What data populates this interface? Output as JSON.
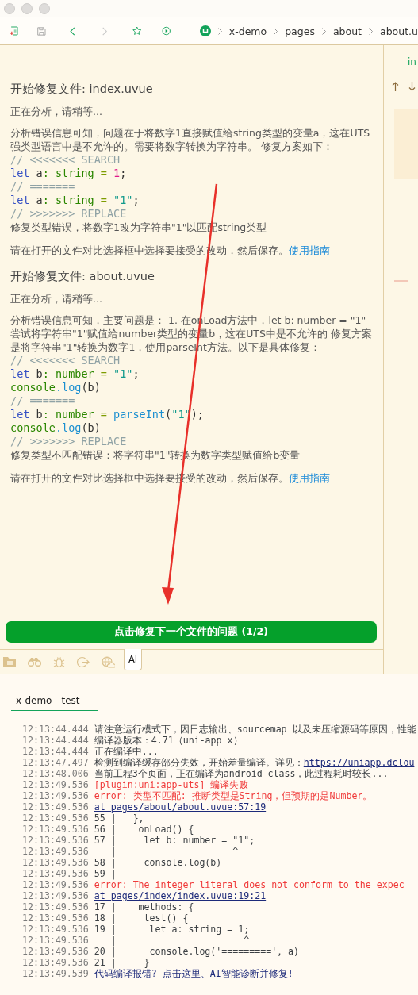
{
  "toolbar": {
    "breadcrumb": [
      "x-demo",
      "pages",
      "about",
      "about.u"
    ],
    "forward_disabled": true
  },
  "side_gutter": {
    "label": "in"
  },
  "ai_panel": {
    "sections": [
      {
        "heading": "开始修复文件: index.uvue",
        "status": "正在分析，请稍等...",
        "analysis": "分析错误信息可知，问题在于将数字1直接赋值给string类型的变量a，这在UTS强类型语言中是不允许的。需要将数字转换为字符串。 修复方案如下：",
        "code": [
          [
            {
              "text": "// <<<<<<< SEARCH",
              "kind": "comment"
            }
          ],
          [
            {
              "text": "let",
              "kind": "kw"
            },
            {
              "text": " a",
              "kind": "plain"
            },
            {
              "text": ": string",
              "kind": "type"
            },
            {
              "text": " = ",
              "kind": "op"
            },
            {
              "text": "1",
              "kind": "num"
            },
            {
              "text": ";",
              "kind": "plain"
            }
          ],
          [
            {
              "text": "// =======",
              "kind": "comment"
            }
          ],
          [
            {
              "text": "let",
              "kind": "kw"
            },
            {
              "text": " a",
              "kind": "plain"
            },
            {
              "text": ": string",
              "kind": "type"
            },
            {
              "text": " = ",
              "kind": "op"
            },
            {
              "text": "\"1\"",
              "kind": "str"
            },
            {
              "text": ";",
              "kind": "plain"
            }
          ],
          [
            {
              "text": "// >>>>>>> REPLACE",
              "kind": "comment"
            }
          ]
        ],
        "summary": "修复类型错误，将数字1改为字符串\"1\"以匹配string类型",
        "instruction": "请在打开的文件对比选择框中选择要接受的改动，然后保存。",
        "link": "使用指南"
      },
      {
        "heading": "开始修复文件: about.uvue",
        "status": "正在分析，请稍等...",
        "analysis": "分析错误信息可知，主要问题是： 1. 在onLoad方法中，let b: number = \"1\" 尝试将字符串\"1\"赋值给number类型的变量b，这在UTS中是不允许的 修复方案是将字符串\"1\"转换为数字1，使用parseInt方法。以下是具体修复：",
        "code": [
          [
            {
              "text": "// <<<<<<< SEARCH",
              "kind": "comment"
            }
          ],
          [
            {
              "text": "let",
              "kind": "kw"
            },
            {
              "text": " b",
              "kind": "plain"
            },
            {
              "text": ": number",
              "kind": "type"
            },
            {
              "text": " = ",
              "kind": "op"
            },
            {
              "text": "\"1\"",
              "kind": "str"
            },
            {
              "text": ";",
              "kind": "plain"
            }
          ],
          [
            {
              "text": "console",
              "kind": "type"
            },
            {
              "text": ".log",
              "kind": "fn"
            },
            {
              "text": "(b)",
              "kind": "plain"
            }
          ],
          [
            {
              "text": "// =======",
              "kind": "comment"
            }
          ],
          [
            {
              "text": "let",
              "kind": "kw"
            },
            {
              "text": " b",
              "kind": "plain"
            },
            {
              "text": ": number",
              "kind": "type"
            },
            {
              "text": " = ",
              "kind": "op"
            },
            {
              "text": "parseInt",
              "kind": "fn"
            },
            {
              "text": "(",
              "kind": "plain"
            },
            {
              "text": "\"1\"",
              "kind": "str"
            },
            {
              "text": ");",
              "kind": "plain"
            }
          ],
          [
            {
              "text": "console",
              "kind": "type"
            },
            {
              "text": ".log",
              "kind": "fn"
            },
            {
              "text": "(b)",
              "kind": "plain"
            }
          ],
          [
            {
              "text": "// >>>>>>> REPLACE",
              "kind": "comment"
            }
          ]
        ],
        "summary": "修复类型不匹配错误：将字符串\"1\"转换为数字类型赋值给b变量",
        "instruction": "请在打开的文件对比选择框中选择要接受的改动，然后保存。",
        "link": "使用指南"
      }
    ],
    "next_button": "点击修复下一个文件的问题 (1/2)"
  },
  "panel_tabs": [
    {
      "kind": "folder",
      "selected": false
    },
    {
      "kind": "binoculars",
      "selected": false
    },
    {
      "kind": "bug",
      "selected": false
    },
    {
      "kind": "export",
      "selected": false
    },
    {
      "kind": "globe",
      "selected": false
    },
    {
      "kind": "text",
      "label": "AI",
      "selected": true
    }
  ],
  "console": {
    "tab": "x-demo - test",
    "lines": [
      {
        "time": "12:13:44.444",
        "text": "请注意运行模式下，因日志输出、sourcemap 以及未压缩源码等原因，性能",
        "kind": "info"
      },
      {
        "time": "12:13:44.444",
        "text": "编译器版本：4.71（uni-app x）",
        "kind": "info"
      },
      {
        "time": "12:13:44.444",
        "text": "正在编译中...",
        "kind": "info"
      },
      {
        "time": "12:13:47.497",
        "text": "检测到编译缓存部分失效，开始差量编译。详见：",
        "link": "https://uniapp.dclou",
        "kind": "info"
      },
      {
        "time": "12:13:48.006",
        "text": "当前工程3个页面，正在编译为android class，此过程耗时较长...",
        "kind": "info"
      },
      {
        "time": "12:13:49.536",
        "text": "[plugin:uni:app-uts] 编译失败",
        "kind": "error"
      },
      {
        "time": "12:13:49.536",
        "text": "error: 类型不匹配: 推断类型是String，但预期的是Number。",
        "kind": "error"
      },
      {
        "time": "12:13:49.536",
        "text": "at pages/about/about.uvue:57:19",
        "kind": "link"
      },
      {
        "time": "12:13:49.536",
        "text": "55 |   },",
        "kind": "info"
      },
      {
        "time": "12:13:49.536",
        "text": "56 |    onLoad() {",
        "kind": "info"
      },
      {
        "time": "12:13:49.536",
        "text": "57 |     let b: number = \"1\";",
        "kind": "info"
      },
      {
        "time": "12:13:49.536",
        "text": "   |                     ^",
        "kind": "info"
      },
      {
        "time": "12:13:49.536",
        "text": "58 |     console.log(b)",
        "kind": "info"
      },
      {
        "time": "12:13:49.536",
        "text": "59 |",
        "kind": "info"
      },
      {
        "time": "12:13:49.536",
        "text": "error: The integer literal does not conform to the expec",
        "kind": "error"
      },
      {
        "time": "12:13:49.536",
        "text": "at pages/index/index.uvue:19:21",
        "kind": "link"
      },
      {
        "time": "12:13:49.536",
        "text": "17 |    methods: {",
        "kind": "info"
      },
      {
        "time": "12:13:49.536",
        "text": "18 |     test() {",
        "kind": "info"
      },
      {
        "time": "12:13:49.536",
        "text": "19 |      let a: string = 1;",
        "kind": "info"
      },
      {
        "time": "12:13:49.536",
        "text": "   |                       ^",
        "kind": "info"
      },
      {
        "time": "12:13:49.536",
        "text": "20 |      console.log('=========', a)",
        "kind": "info"
      },
      {
        "time": "12:13:49.536",
        "text": "21 |     }",
        "kind": "info"
      },
      {
        "time": "12:13:49.539",
        "text": "代码编译报错? 点击这里、AI智能诊断并修复!",
        "kind": "link"
      }
    ]
  }
}
